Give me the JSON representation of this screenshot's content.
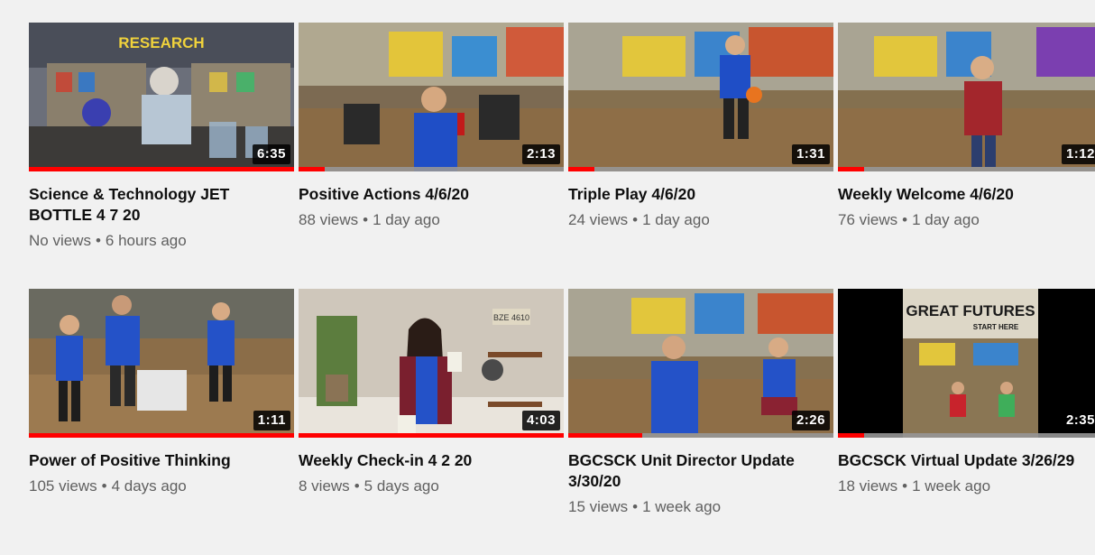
{
  "videos": [
    {
      "title": "Science & Technology JET BOTTLE 4 7 20",
      "views": "No views",
      "age": "6 hours ago",
      "duration": "6:35",
      "watched_fraction": 1.0,
      "thumb": "lab-with-research-banner"
    },
    {
      "title": "Positive Actions 4/6/20",
      "views": "88 views",
      "age": "1 day ago",
      "duration": "2:13",
      "watched_fraction": 0.1,
      "thumb": "gym-interview-microphone"
    },
    {
      "title": "Triple Play 4/6/20",
      "views": "24 views",
      "age": "1 day ago",
      "duration": "1:31",
      "watched_fraction": 0.1,
      "thumb": "gym-ball-presenter"
    },
    {
      "title": "Weekly Welcome 4/6/20",
      "views": "76 views",
      "age": "1 day ago",
      "duration": "1:12",
      "watched_fraction": 0.1,
      "thumb": "gym-plaid-presenter"
    },
    {
      "title": "Power of Positive Thinking",
      "views": "105 views",
      "age": "4 days ago",
      "duration": "1:11",
      "watched_fraction": 1.0,
      "thumb": "three-presenters"
    },
    {
      "title": "Weekly Check-in 4 2 20",
      "views": "8 views",
      "age": "5 days ago",
      "duration": "4:03",
      "watched_fraction": 1.0,
      "thumb": "desk-presenter-jar"
    },
    {
      "title": "BGCSCK Unit Director Update 3/30/20",
      "views": "15 views",
      "age": "1 week ago",
      "duration": "2:26",
      "watched_fraction": 0.28,
      "thumb": "two-presenters-gym"
    },
    {
      "title": "BGCSCK Virtual Update 3/26/29",
      "views": "18 views",
      "age": "1 week ago",
      "duration": "2:35",
      "watched_fraction": 0.1,
      "thumb": "great-futures-banner"
    }
  ],
  "thumb_text": {
    "research_banner": "RESEARCH",
    "great_futures": "GREAT FUTURES",
    "start_here": "START HERE",
    "plate": "BZE 4610"
  },
  "colors": {
    "progress": "#ff0000",
    "background": "#f1f1f1",
    "title": "#0f0f0f",
    "meta": "#606060"
  }
}
